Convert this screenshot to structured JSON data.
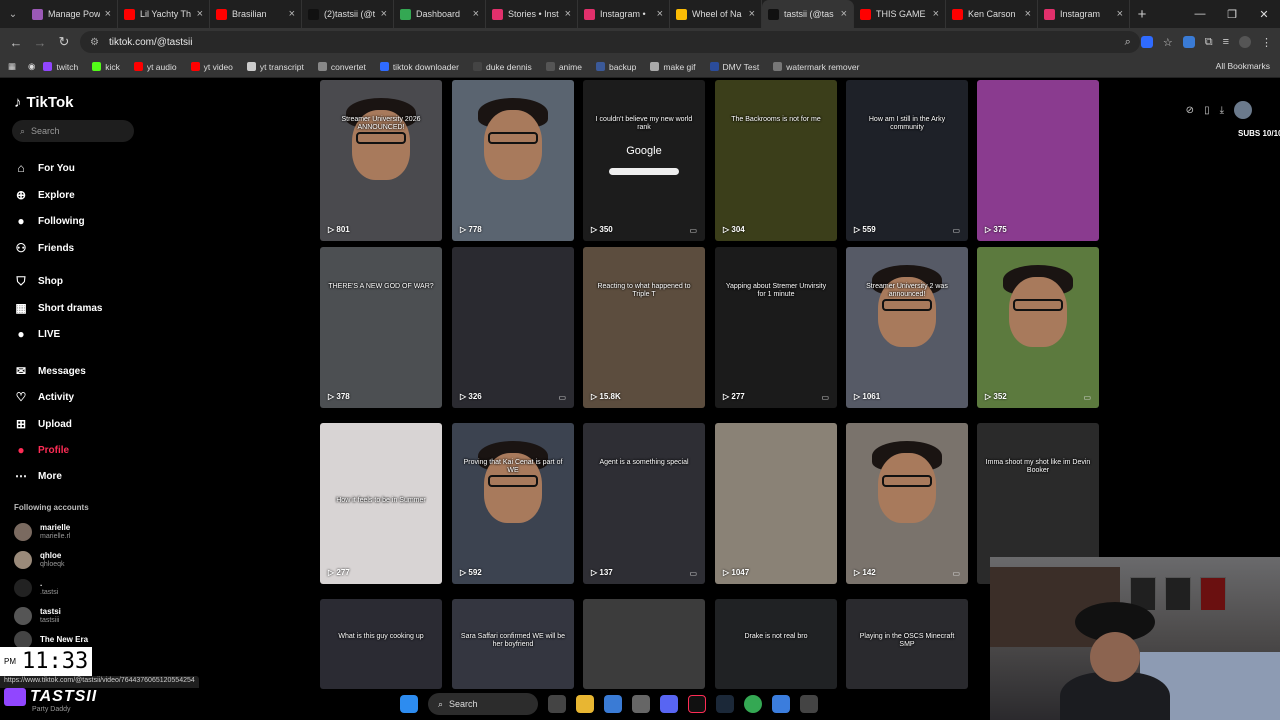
{
  "tabs": [
    {
      "title": "Manage Pow",
      "color": "#9b59b6"
    },
    {
      "title": "Lil Yachty Th",
      "color": "#ff0000"
    },
    {
      "title": "Brasilian",
      "color": "#ff0000"
    },
    {
      "title": "(2)tastsii (@t",
      "color": "#111111"
    },
    {
      "title": "Dashboard",
      "color": "#34a853"
    },
    {
      "title": "Stories • Inst",
      "color": "#e1306c"
    },
    {
      "title": "Instagram •",
      "color": "#e1306c"
    },
    {
      "title": "Wheel of Na",
      "color": "#fbbc05"
    },
    {
      "title": "tastsii (@tas",
      "color": "#111111",
      "active": true
    },
    {
      "title": "THIS GAME",
      "color": "#ff0000"
    },
    {
      "title": "Ken Carson",
      "color": "#ff0000"
    },
    {
      "title": "Instagram",
      "color": "#e1306c"
    }
  ],
  "address": {
    "url": "tiktok.com/@tastsii"
  },
  "bookmarks": [
    {
      "label": "twitch",
      "color": "#9146ff"
    },
    {
      "label": "kick",
      "color": "#53fc18"
    },
    {
      "label": "yt audio",
      "color": "#ff0000"
    },
    {
      "label": "yt video",
      "color": "#ff0000"
    },
    {
      "label": "yt transcript",
      "color": "#cccccc"
    },
    {
      "label": "convertet",
      "color": "#888888"
    },
    {
      "label": "tiktok downloader",
      "color": "#2f6bff"
    },
    {
      "label": "duke dennis",
      "color": "#444444"
    },
    {
      "label": "anime",
      "color": "#555555"
    },
    {
      "label": "backup",
      "color": "#3b5998"
    },
    {
      "label": "make gif",
      "color": "#aaaaaa"
    },
    {
      "label": "DMV Test",
      "color": "#2b4c9b"
    },
    {
      "label": "watermark remover",
      "color": "#777777"
    }
  ],
  "bookmarks_all": "All Bookmarks",
  "sidebar": {
    "logo": "TikTok",
    "search_placeholder": "Search",
    "nav": [
      {
        "label": "For You",
        "icon": "⌂"
      },
      {
        "label": "Explore",
        "icon": "⊕"
      },
      {
        "label": "Following",
        "icon": "●"
      },
      {
        "label": "Friends",
        "icon": "⚇"
      },
      {
        "label": "Shop",
        "icon": "⛉"
      },
      {
        "label": "Short dramas",
        "icon": "▦"
      },
      {
        "label": "LIVE",
        "icon": "●"
      },
      {
        "label": "Messages",
        "icon": "✉"
      },
      {
        "label": "Activity",
        "icon": "♡"
      },
      {
        "label": "Upload",
        "icon": "⊞"
      },
      {
        "label": "Profile",
        "icon": "●",
        "active": true
      },
      {
        "label": "More",
        "icon": "⋯"
      }
    ],
    "following_header": "Following accounts",
    "following": [
      {
        "name": "marielle",
        "handle": "marielle.rl"
      },
      {
        "name": "qhloe",
        "handle": "qhloeqk"
      },
      {
        "name": ".",
        "handle": ".tastsi"
      },
      {
        "name": "tastsi",
        "handle": "tastsiii"
      },
      {
        "name": "The New Era",
        "handle": ""
      }
    ]
  },
  "videos": [
    {
      "caption": "Streamer University 2026 ANNOUNCED!",
      "views": "801",
      "bg": "#4a4a4e",
      "face": true
    },
    {
      "caption": "",
      "views": "778",
      "bg": "#5a6470",
      "face": true
    },
    {
      "caption": "I couldn't believe my new world rank",
      "views": "350",
      "bg": "#1c1c1c",
      "google": true,
      "lock": true
    },
    {
      "caption": "The Backrooms is not for me",
      "views": "304",
      "bg": "#3b3e1a"
    },
    {
      "caption": "How am I still in the Arky community",
      "views": "559",
      "bg": "#1e2128",
      "lock": true
    },
    {
      "caption": "",
      "views": "375",
      "bg": "#8a3b8f"
    },
    {
      "caption": "THERE'S A NEW GOD OF WAR?",
      "views": "378",
      "bg": "#4c4f52"
    },
    {
      "caption": "",
      "views": "326",
      "bg": "#2a2a30",
      "lock": true
    },
    {
      "caption": "Reacting to what happened to Triple T",
      "views": "15.8K",
      "bg": "#5c4d3e"
    },
    {
      "caption": "Yapping about Stremer Unvirsity for 1 minute",
      "views": "277",
      "bg": "#1b1b1b",
      "lock": true
    },
    {
      "caption": "Streamer University 2 was announced!",
      "views": "1061",
      "bg": "#565a66",
      "face": true
    },
    {
      "caption": "",
      "views": "352",
      "bg": "#5c7a3e",
      "face": true,
      "lock": true
    },
    {
      "caption": "How it feels to be in Summer",
      "views": "277",
      "bg": "#d8d4d4"
    },
    {
      "caption": "Proving that Kai Cenat is part of WE",
      "views": "592",
      "bg": "#3c4350",
      "face": true
    },
    {
      "caption": "Agent is a something special",
      "views": "137",
      "bg": "#2e2e34",
      "lock": true
    },
    {
      "caption": "",
      "views": "1047",
      "bg": "#8a8276"
    },
    {
      "caption": "",
      "views": "142",
      "bg": "#7a736c",
      "face": true,
      "lock": true
    },
    {
      "caption": "Imma shoot my shot like im Devin Booker",
      "views": "",
      "bg": "#2a2a2a"
    },
    {
      "caption": "What is this guy cooking up",
      "views": "",
      "bg": "#2b2b33"
    },
    {
      "caption": "Sara Saffari confirmed WE will be her boyfriend",
      "views": "",
      "bg": "#343640"
    },
    {
      "caption": "",
      "views": "",
      "bg": "#3c3c3c"
    },
    {
      "caption": "Drake is not real bro",
      "views": "",
      "bg": "#202224"
    },
    {
      "caption": "Playing in the OSCS Minecraft SMP",
      "views": "",
      "bg": "#2a2a2e"
    }
  ],
  "subs_text": "SUBS 10/10",
  "clock": {
    "ampm": "PM",
    "time": "11:33"
  },
  "status_url": "https://www.tiktok.com/@tastsii/video/7644376065120554254",
  "brand": {
    "name": "TASTSII",
    "sub": "Party Daddy"
  },
  "taskbar": {
    "search": "Search"
  }
}
